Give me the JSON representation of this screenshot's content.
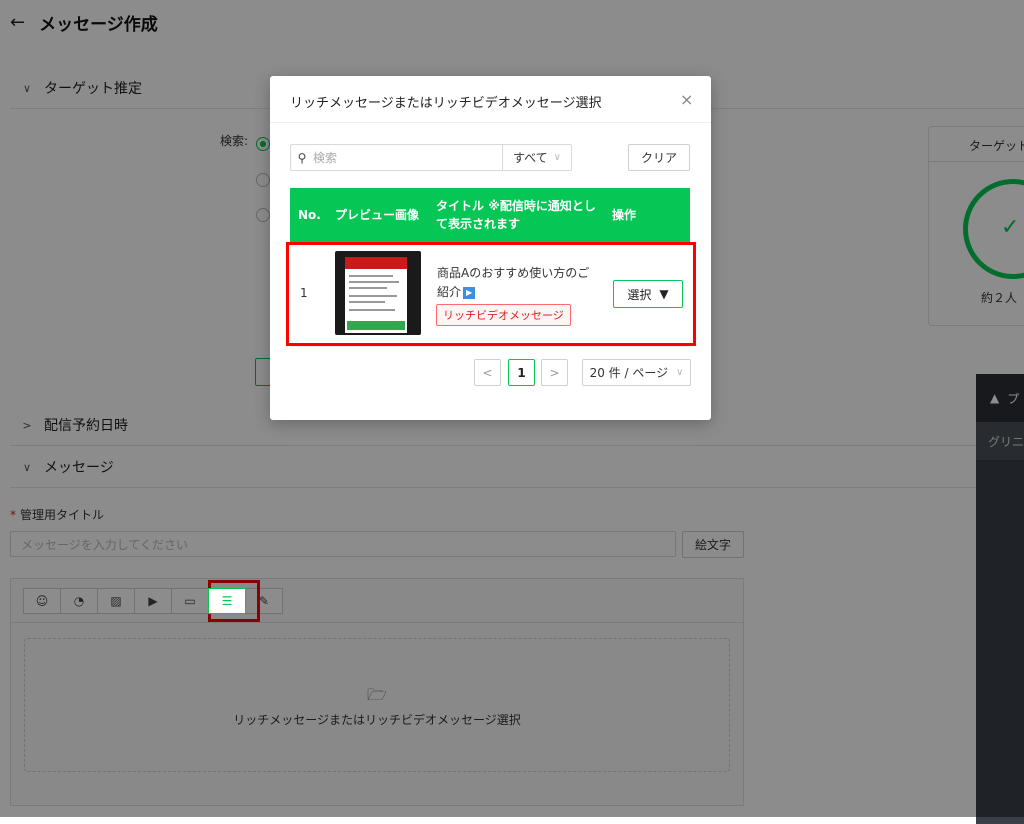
{
  "page": {
    "back_icon": "←",
    "title": "メッセージ作成"
  },
  "sections": {
    "target": "ターゲット推定",
    "schedule": "配信予約日時",
    "message": "メッセージ"
  },
  "search_label": "検索:",
  "target_card": {
    "title": "ターゲット",
    "count": "約２人"
  },
  "form": {
    "title_label": "管理用タイトル",
    "title_placeholder": "メッセージを入力してください",
    "emoji_button": "絵文字"
  },
  "toolbar": {
    "tools": [
      "chat-icon",
      "sticker-icon",
      "image-icon",
      "video-icon",
      "folder-icon",
      "rich-message-icon",
      "pen-icon"
    ],
    "active_tool": "rich-message-icon"
  },
  "dropzone": {
    "icon": "folder-icon",
    "label": "リッチメッセージまたはリッチビデオメッセージ選択"
  },
  "preview": {
    "header": "プ",
    "sub": "グリニ"
  },
  "modal": {
    "title": "リッチメッセージまたはリッチビデオメッセージ選択",
    "close": "×",
    "search_placeholder": "検索",
    "filter_value": "すべて",
    "clear_button": "クリア",
    "columns": [
      "No.",
      "プレビュー画像",
      "タイトル ※配信時に通知として表示されます",
      "操作"
    ],
    "rows": [
      {
        "no": "1",
        "title": "商品Aのおすすめ使い方のご紹介",
        "type_badge": "リッチビデオメッセージ",
        "action": "選択"
      }
    ],
    "pagination": {
      "prev": "<",
      "current": "1",
      "next": ">",
      "page_size": "20 件 / ページ"
    }
  },
  "colors": {
    "accent": "#06c755",
    "highlight": "#ff0000",
    "badge": "#e02020"
  }
}
